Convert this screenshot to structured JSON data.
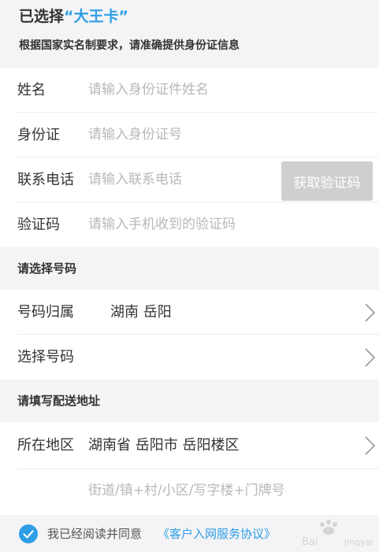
{
  "header": {
    "selected_prefix": "已选择",
    "selected_card": "“大王卡”",
    "subtitle": "根据国家实名制要求，请准确提供身份证信息"
  },
  "identity": {
    "name_label": "姓名",
    "name_placeholder": "请输入身份证件姓名",
    "id_label": "身份证",
    "id_placeholder": "请输入身份证号",
    "phone_label": "联系电话",
    "phone_placeholder": "请输入联系电话",
    "get_code_label": "获取验证码",
    "code_label": "验证码",
    "code_placeholder": "请输入手机收到的验证码"
  },
  "number_section": {
    "title": "请选择号码",
    "region_label": "号码归属",
    "region_value": "湖南 岳阳",
    "choose_label": "选择号码"
  },
  "address_section": {
    "title": "请填写配送地址",
    "area_label": "所在地区",
    "area_value": "湖南省 岳阳市 岳阳楼区",
    "detail_placeholder": "街道/镇+村/小区/写字楼+门牌号"
  },
  "agreement": {
    "text": "我已经阅读并同意",
    "link": "《客户入网服务协议》",
    "checked": true,
    "accent_color": "#2e9ee5"
  },
  "colors": {
    "accent": "#2e9ee5",
    "button_disabled": "#cfcfcf",
    "background": "#f4f4f6"
  },
  "icons": {
    "chevron": "chevron-right-icon",
    "check": "check-circle-icon"
  }
}
